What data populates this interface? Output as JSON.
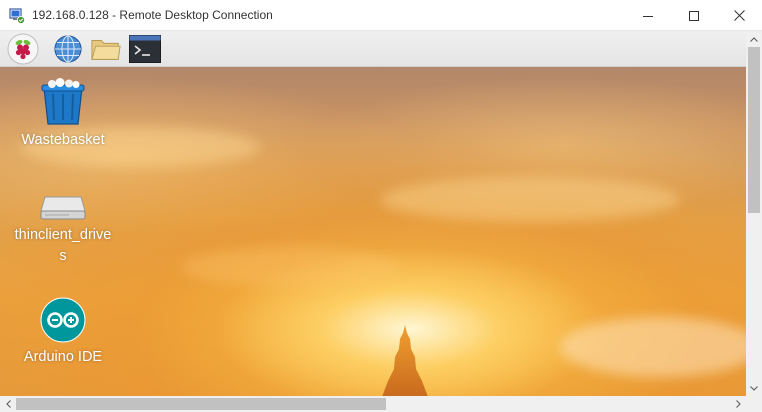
{
  "window": {
    "title": "192.168.0.128 - Remote Desktop Connection",
    "icon": "remote-desktop-icon",
    "controls": [
      "minimize-icon",
      "maximize-icon",
      "close-icon"
    ]
  },
  "panel": {
    "launchers": [
      {
        "name": "raspberry-menu",
        "icon": "raspberry-pi-icon"
      },
      {
        "name": "web-browser",
        "icon": "globe-icon"
      },
      {
        "name": "file-manager",
        "icon": "folder-icon"
      },
      {
        "name": "terminal",
        "icon": "terminal-icon"
      }
    ]
  },
  "desktop": {
    "icons": [
      {
        "label": "Wastebasket",
        "icon": "trash-icon"
      },
      {
        "label": "thinclient_drives",
        "icon": "drive-icon"
      },
      {
        "label": "Arduino IDE",
        "icon": "arduino-icon"
      }
    ]
  },
  "colors": {
    "accent_sky": "#e0a04c",
    "arduino_teal": "#00979c",
    "trash_blue": "#1e78c8"
  }
}
